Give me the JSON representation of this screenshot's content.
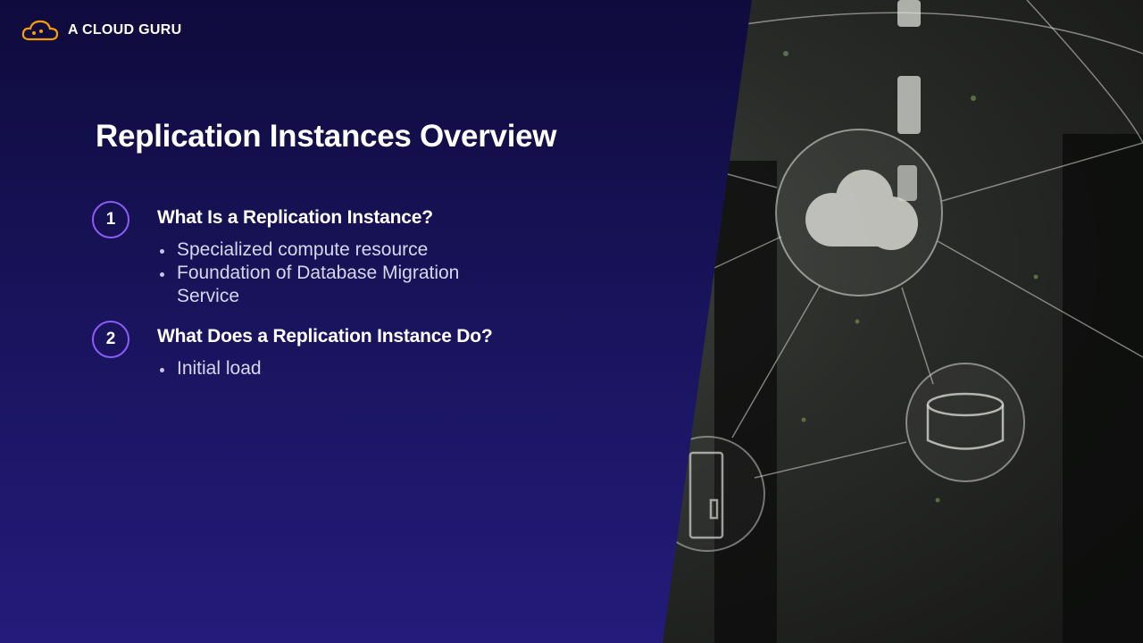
{
  "brand": {
    "name": "A CLOUD GURU",
    "logo_icon": "cloud-logo-icon",
    "accent": "#f59e0b"
  },
  "slide": {
    "title": "Replication Instances Overview",
    "sections": [
      {
        "number": "1",
        "heading": "What Is a Replication Instance?",
        "bullets": [
          "Specialized compute resource",
          "Foundation of Database Migration Service"
        ]
      },
      {
        "number": "2",
        "heading": "What Does a Replication Instance Do?",
        "bullets": [
          "Initial load"
        ]
      }
    ]
  },
  "colors": {
    "background": "#18135a",
    "number_ring": "#8b5cf6",
    "text": "#ffffff",
    "bullet_text": "#d8d6ee"
  },
  "image": {
    "icons": [
      "cloud-icon",
      "database-icon",
      "server-icon"
    ]
  }
}
